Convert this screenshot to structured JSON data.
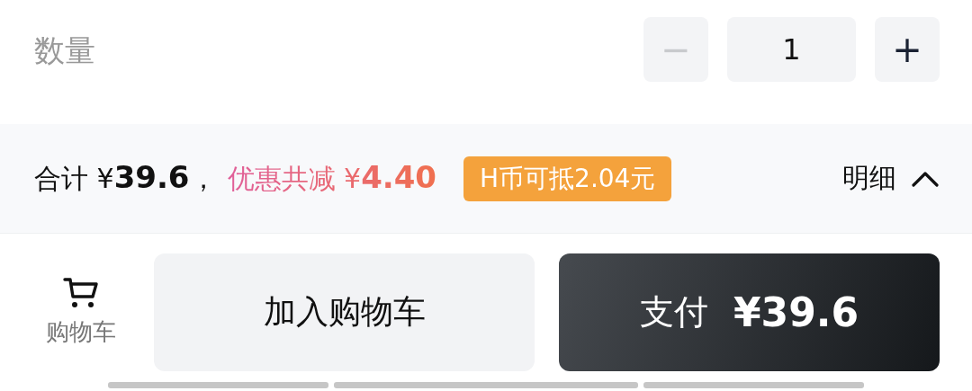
{
  "quantity": {
    "label": "数量",
    "minus": "−",
    "value": "1",
    "plus": "+",
    "minus_disabled": true
  },
  "summary": {
    "total": "合计 ¥**39.6**，",
    "discount": "优惠共减 ¥**4.40**",
    "coin_badge": "H币可抵2.04元",
    "detail_label": "明细",
    "detail_expanded": true
  },
  "actions": {
    "cart_label": "购物车",
    "add_to_cart": "加入购物车",
    "pay_label": "支付",
    "pay_amount": "¥39.6"
  }
}
